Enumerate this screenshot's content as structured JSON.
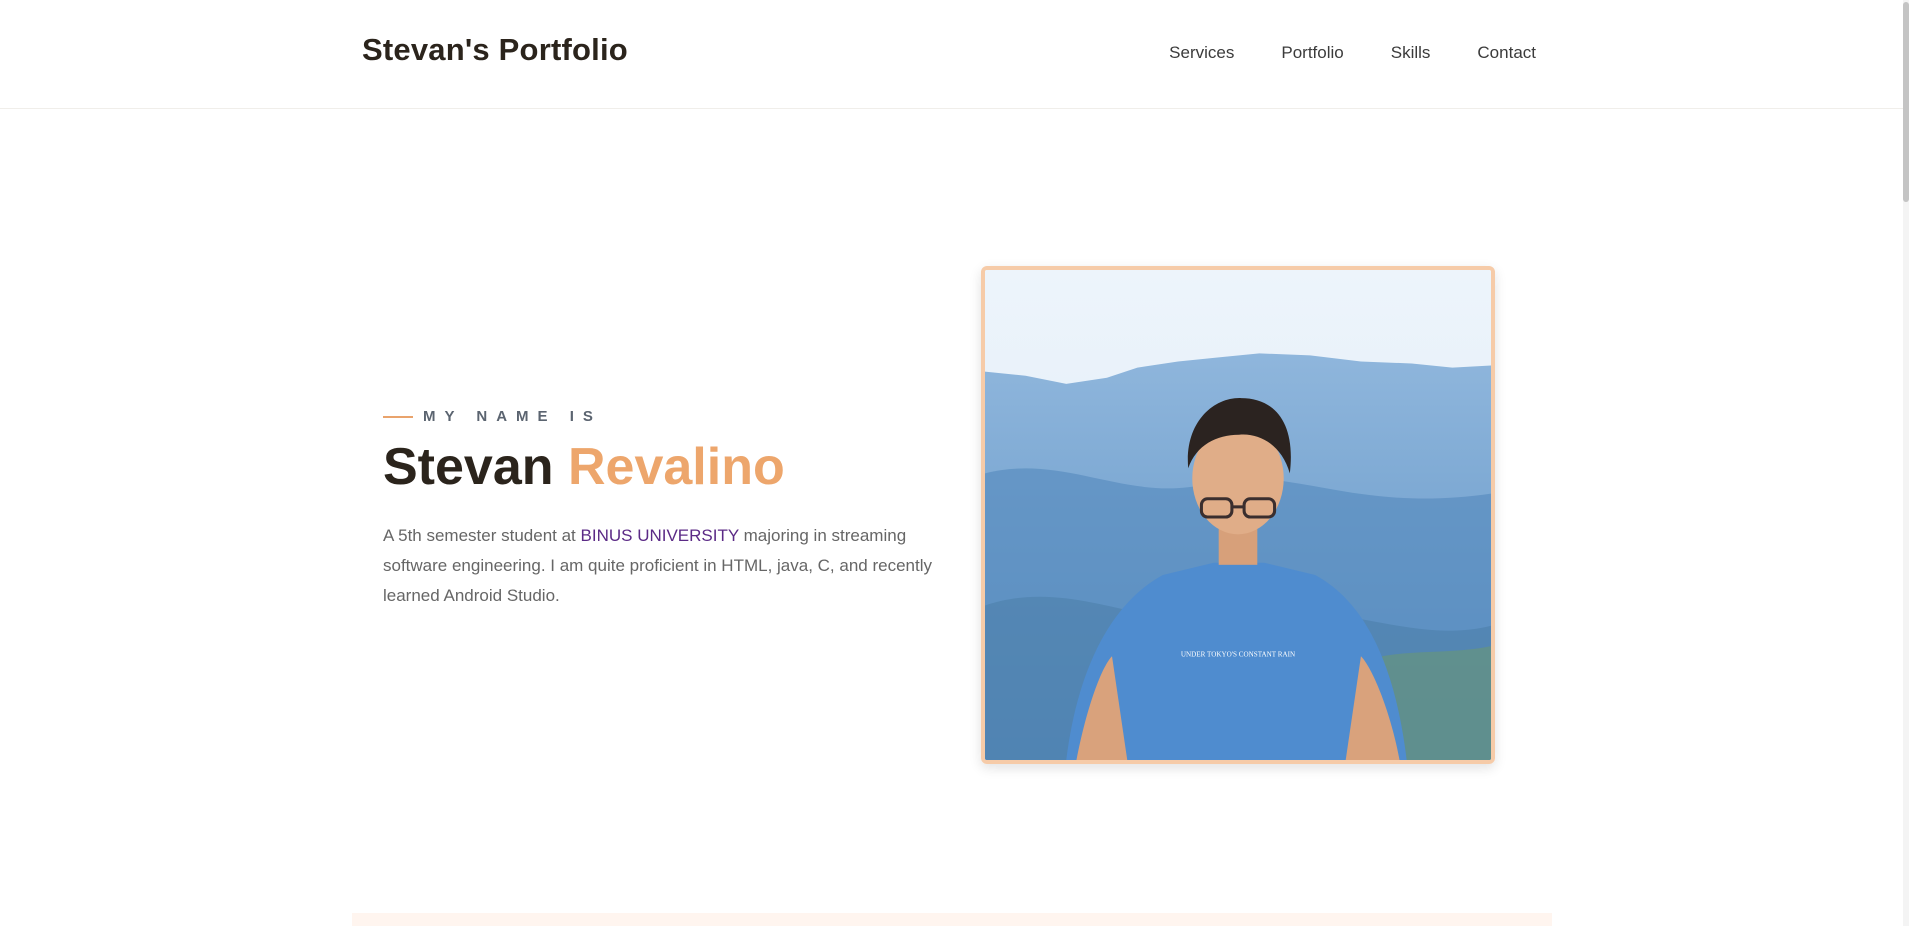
{
  "header": {
    "brand": "Stevan's Portfolio",
    "nav": [
      "Services",
      "Portfolio",
      "Skills",
      "Contact"
    ]
  },
  "hero": {
    "eyebrow": "MY NAME IS",
    "first_name": "Stevan",
    "last_name": "Revalino",
    "bio": {
      "before": "A 5th semester student at ",
      "university": "BINUS UNIVERSITY",
      "after": " majoring in streaming software engineering. I am quite proficient in HTML, java, C, and recently learned Android Studio."
    },
    "photo": {
      "shirt_text": "UNDER TOKYO'S CONSTANT RAIN"
    }
  },
  "colors": {
    "accent": "#eda66c",
    "frame": "#f6cba8",
    "heading": "#2b241c",
    "link": "#5b2a86"
  }
}
